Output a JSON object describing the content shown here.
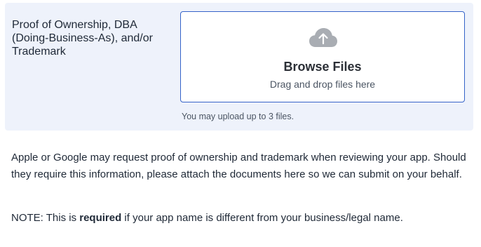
{
  "upload_field": {
    "label": "Proof of Ownership, DBA\n(Doing-Business-As), and/or\nTrademark",
    "dropzone": {
      "icon": "cloud-upload-icon",
      "title": "Browse Files",
      "subtitle": "Drag and drop files here"
    },
    "hint": "You may upload up to 3 files."
  },
  "description": "Apple or Google may request proof of ownership and trademark when reviewing your app. Should they require this information, please attach the documents here so we can submit on your behalf.",
  "note": {
    "prefix": "NOTE: This is ",
    "emphasis": "required",
    "suffix": " if your app name is different from your business/legal name."
  },
  "colors": {
    "panel_background": "#eef2fb",
    "dropzone_border": "#3563c9",
    "icon_gray": "#a9adb3"
  }
}
